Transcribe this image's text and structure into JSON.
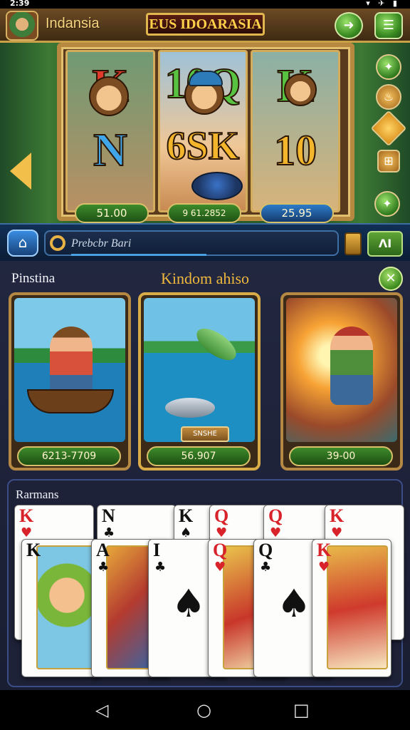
{
  "status_bar": {
    "time": "2:39",
    "icons": "▾ ✈ ▮"
  },
  "header": {
    "region": "Indansia",
    "brand": "EUS IDOARASIA",
    "buttons": [
      {
        "icon": "arrow-icon",
        "glyph": "➜"
      },
      {
        "icon": "menu-icon",
        "glyph": "☰"
      }
    ]
  },
  "slot": {
    "reels": [
      {
        "top": "K",
        "middle": "N",
        "payline": "51.00"
      },
      {
        "top": "10",
        "middle": "6SK",
        "payline": "9 61.2852"
      },
      {
        "top": "K",
        "middle": "10",
        "payline": "25.95"
      }
    ],
    "top_middle_suffix": "Q"
  },
  "search": {
    "placeholder": "Prebcbr Bari",
    "button_label": "ΛΙ"
  },
  "panel": {
    "left_label": "Pinstina",
    "title": "Kindom ahiso",
    "games": [
      {
        "name": "boat-game",
        "price": "6213-7709",
        "tag": ""
      },
      {
        "name": "fishing-game",
        "price": "56.907",
        "tag": "SNSHE"
      },
      {
        "name": "slingshot-game",
        "price": "39-00",
        "tag": ""
      }
    ],
    "cards_label": "Rarmans",
    "back_row": [
      {
        "rank": "K",
        "suit": "♥",
        "color": "red"
      },
      {
        "rank": "N",
        "suit": "♣",
        "color": "black"
      },
      {
        "rank": "K",
        "suit": "♠",
        "color": "black"
      },
      {
        "rank": "Q",
        "suit": "♥",
        "color": "red"
      },
      {
        "rank": "Q",
        "suit": "♥",
        "color": "red"
      },
      {
        "rank": "K",
        "suit": "♥",
        "color": "red"
      }
    ],
    "front_row": [
      {
        "rank": "K",
        "suit": "",
        "color": "black"
      },
      {
        "rank": "A",
        "suit": "♣",
        "color": "black"
      },
      {
        "rank": "I",
        "suit": "♣",
        "color": "black",
        "center": "♠"
      },
      {
        "rank": "Q",
        "suit": "♥",
        "color": "red"
      },
      {
        "rank": "Q",
        "suit": "♣",
        "color": "black",
        "center": "♠"
      },
      {
        "rank": "K",
        "suit": "♥",
        "color": "red"
      }
    ]
  },
  "nav": {
    "back": "◁",
    "home": "○",
    "recents": "□"
  }
}
